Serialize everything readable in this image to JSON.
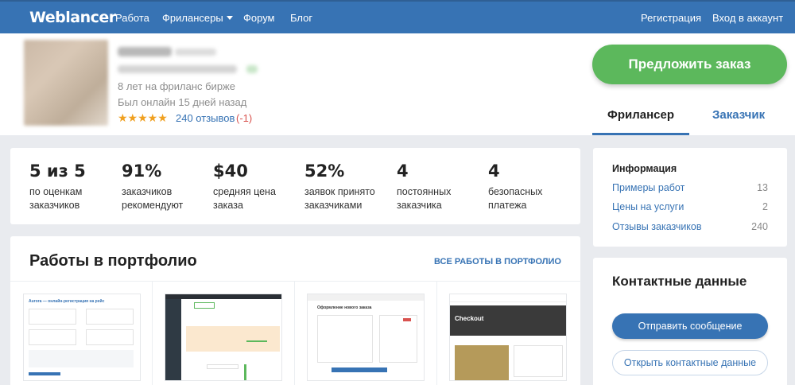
{
  "nav": {
    "logo": "Weblancer",
    "links": [
      "Работа",
      "Фрилансеры",
      "Форум",
      "Блог"
    ],
    "register": "Регистрация",
    "login": "Вход в аккаунт"
  },
  "profile": {
    "experience": "8 лет на фриланс бирже",
    "last_online": "Был онлайн 15 дней назад",
    "stars": "★★★★★",
    "reviews": "240 отзывов",
    "negative": "(-1)",
    "offer_button": "Предложить заказ",
    "tabs": [
      "Фрилансер",
      "Заказчик"
    ]
  },
  "stats": [
    {
      "value": "5 из 5",
      "label1": "по оценкам",
      "label2": "заказчиков"
    },
    {
      "value": "91%",
      "label1": "заказчиков",
      "label2": "рекомендуют"
    },
    {
      "value": "$40",
      "label1": "средняя цена",
      "label2": "заказа"
    },
    {
      "value": "52%",
      "label1": "заявок принято",
      "label2": "заказчиками"
    },
    {
      "value": "4",
      "label1": "постоянных",
      "label2": "заказчика"
    },
    {
      "value": "4",
      "label1": "безопасных",
      "label2": "платежа"
    }
  ],
  "info": {
    "title": "Информация",
    "rows": [
      {
        "label": "Примеры работ",
        "count": "13"
      },
      {
        "label": "Цены на услуги",
        "count": "2"
      },
      {
        "label": "Отзывы заказчиков",
        "count": "240"
      }
    ]
  },
  "portfolio": {
    "title": "Работы в портфолио",
    "all_link": "ВСЕ РАБОТЫ В ПОРТФОЛИО",
    "thumb1_title": "Aurora — онлайн-регистрация на рейс",
    "thumb3_title": "Оформление нового заказа",
    "thumb4_title": "Checkout"
  },
  "contacts": {
    "title": "Контактные данные",
    "send_message": "Отправить сообщение",
    "open_contacts": "Открыть контактные данные"
  },
  "colors": {
    "nav_bg": "#3773b4",
    "accent_green": "#5cb85c",
    "link_blue": "#3773b4",
    "star": "#f0a020"
  }
}
